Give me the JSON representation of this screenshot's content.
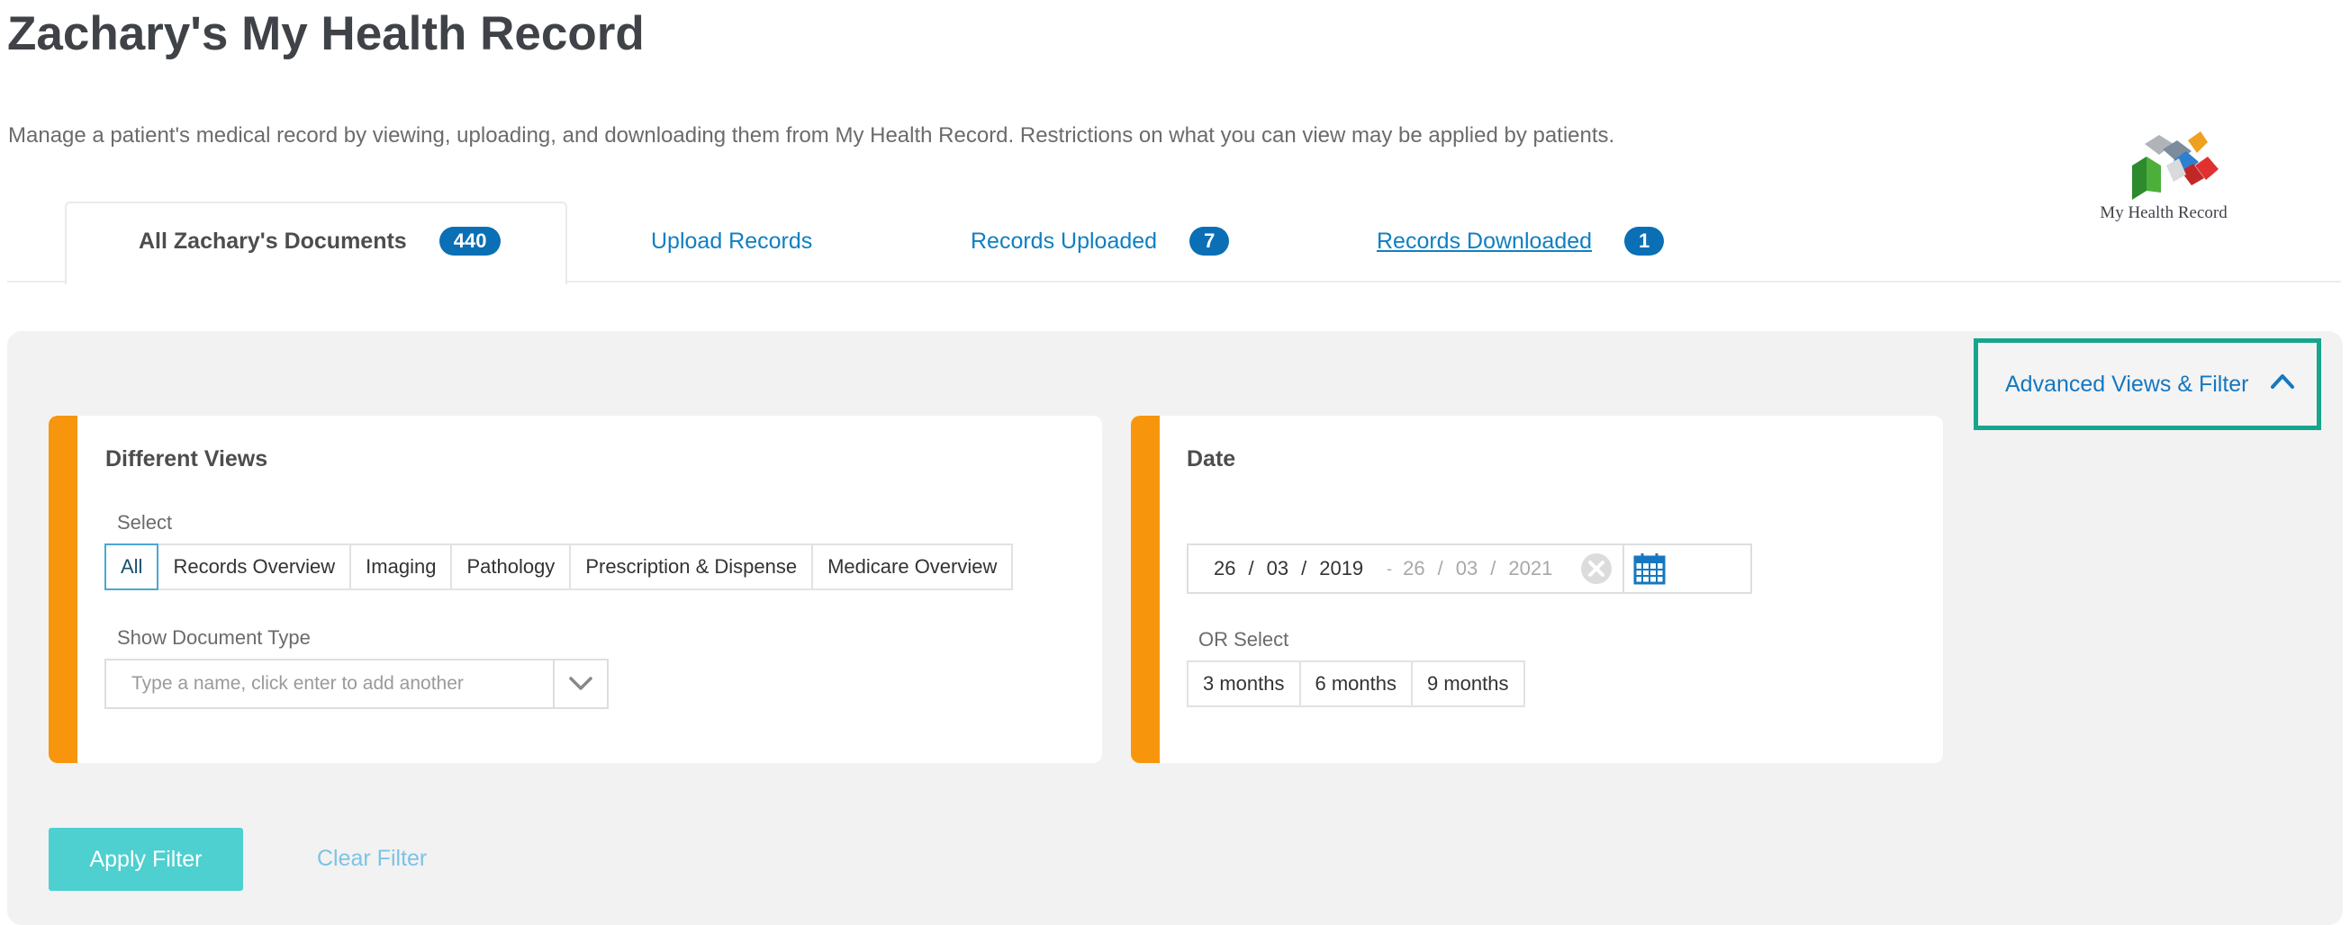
{
  "page": {
    "title": "Zachary's My Health Record",
    "description": "Manage a patient's medical record by viewing, uploading, and downloading them from My Health Record. Restrictions on what you can view may be applied by patients."
  },
  "logo": {
    "text": "My Health Record"
  },
  "tabs": [
    {
      "label": "All Zachary's Documents",
      "badge": "440"
    },
    {
      "label": "Upload Records"
    },
    {
      "label": "Records Uploaded",
      "badge": "7"
    },
    {
      "label": "Records Downloaded",
      "badge": "1"
    }
  ],
  "filter": {
    "toggle_label": "Advanced Views & Filter",
    "views": {
      "title": "Different Views",
      "select_label": "Select",
      "options": [
        "All",
        "Records Overview",
        "Imaging",
        "Pathology",
        "Prescription & Dispense",
        "Medicare Overview"
      ],
      "selected": "All",
      "doc_type_label": "Show Document Type",
      "doc_type_placeholder": "Type a name, click enter to add another"
    },
    "date": {
      "title": "Date",
      "from": {
        "day": "26",
        "month": "03",
        "year": "2019"
      },
      "to": {
        "day": "26",
        "month": "03",
        "year": "2021"
      },
      "separator": "/",
      "range_separator": "-",
      "or_select_label": "OR Select",
      "presets": [
        "3 months",
        "6 months",
        "9 months"
      ]
    },
    "apply_label": "Apply Filter",
    "clear_label": "Clear Filter"
  },
  "colors": {
    "link_blue": "#0f7fc2",
    "badge_blue": "#0a6fb5",
    "accent_orange": "#f7960d",
    "highlight_teal": "#17a58d",
    "apply_teal": "#4ecfd0"
  }
}
